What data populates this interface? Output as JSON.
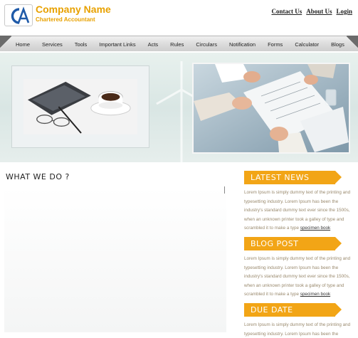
{
  "brand": {
    "logo_text": "CA",
    "name": "Company Name",
    "tagline": "Chartered Accountant"
  },
  "top_links": [
    "Contact Us",
    "About Us",
    "Login"
  ],
  "nav": {
    "items": [
      "Home",
      "Services",
      "Tools",
      "Important Links",
      "Acts",
      "Rules",
      "Circulars",
      "Notification",
      "Forms",
      "Calculator",
      "Blogs"
    ]
  },
  "main": {
    "heading": "WHAT WE DO ?"
  },
  "sidebar": {
    "sections": [
      {
        "title": "LATEST NEWS",
        "text": "Lorem Ipsum is simply dummy text of the printing and typesetting industry. Lorem Ipsum has been the industry's standard dummy text ever since the 1500s, when an unknown printer took a galley of type and scrambled it to make a type",
        "link": "specimen book"
      },
      {
        "title": "BLOG POST",
        "text": "Lorem Ipsum is simply dummy text of the printing and typesetting industry. Lorem Ipsum has been the industry's standard dummy text ever since the 1500s, when an unknown printer took a galley of type and scrambled it to make a type",
        "link": "specimen book"
      },
      {
        "title": "DUE DATE",
        "text": "Lorem Ipsum is simply dummy text of the printing and typesetting industry. Lorem Ipsum has been the"
      }
    ]
  },
  "colors": {
    "brand": "#e8a100",
    "ribbon": "#f2a516",
    "body_text": "#9a8a6e"
  }
}
